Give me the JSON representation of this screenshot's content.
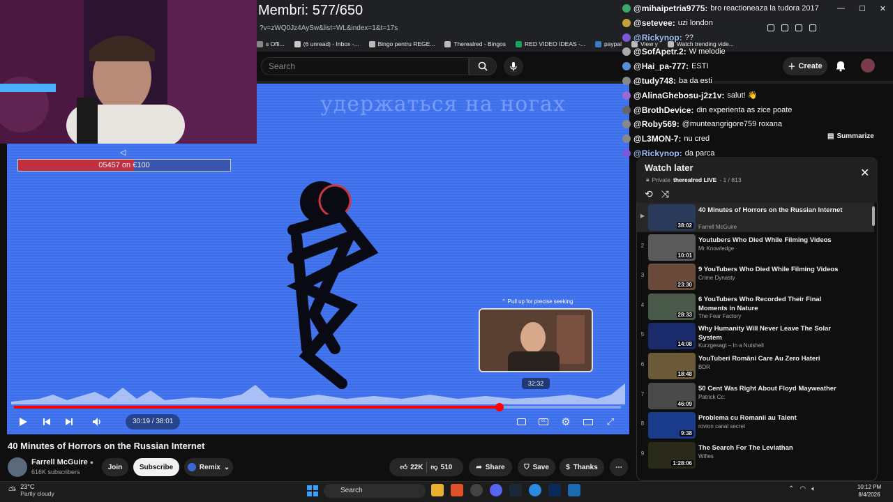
{
  "stream_overlay": {
    "members": "Membri: 577/650",
    "donation_arrow": "◁",
    "donation_text": "05457 on €100"
  },
  "browser": {
    "url": "?v=zWQ0Jz4AySw&list=WL&index=1&t=17s",
    "bookmarks": [
      {
        "label": "s Offi...",
        "color": "#888"
      },
      {
        "label": "(6 unread) - Inbox -...",
        "color": "#c9c9c9"
      },
      {
        "label": "Bingo pentru REGE...",
        "color": "#bbb"
      },
      {
        "label": "Therealred - Bingos",
        "color": "#bbb"
      },
      {
        "label": "RED VIDEO IDEAS -...",
        "color": "#1aa260"
      },
      {
        "label": "paypal",
        "color": "#3b7bbf"
      },
      {
        "label": "View y",
        "color": "#bbb"
      },
      {
        "label": "Watch trending vide...",
        "color": "#bbb"
      }
    ]
  },
  "header": {
    "search_placeholder": "Search",
    "create_label": "Create"
  },
  "chat": [
    {
      "user": "@mihaipetria9775:",
      "msg": "bro reactioneaza la tudora 2017",
      "badge": "#3aa86b"
    },
    {
      "user": "@setevee:",
      "msg": "uzi london",
      "badge": "#c9a13a"
    },
    {
      "user": "@Rickynop:",
      "msg": "??",
      "badge": "#7a5ad9",
      "user_color": "#9ec3ff"
    },
    {
      "user": "@SofApetr.2:",
      "msg": "W melodie",
      "badge": "#aaa"
    },
    {
      "user": "@Hai_pa-777:",
      "msg": "ESTI",
      "badge": "#5a8fd9"
    },
    {
      "user": "@tudy748:",
      "msg": "ba da esti",
      "badge": "#888"
    },
    {
      "user": "@AlinaGhebosu-j2z1v:",
      "msg": "salut! 👋",
      "badge": "#9a6ad0"
    },
    {
      "user": "@BrothDevice:",
      "msg": "din experienta as zice poate",
      "badge": "#666"
    },
    {
      "user": "@Roby569:",
      "msg": "@munteangrigore759 roxana",
      "badge": "#888"
    },
    {
      "user": "@L3MON-7:",
      "msg": "nu cred",
      "badge": "#888"
    },
    {
      "user": "@Rickynop:",
      "msg": "da parca",
      "badge": "#7a5ad9",
      "user_color": "#9ec3ff"
    }
  ],
  "player": {
    "title_art": "удержаться на ногах",
    "seek_hint": "⌃ Pull up for precise seeking",
    "seek_time": "32:32",
    "time": "30:19 / 38:01",
    "progress": 0.8
  },
  "video": {
    "title": "40 Minutes of Horrors on the Russian Internet",
    "channel": "Farrell McGuire",
    "subscribers": "616K subscribers",
    "join": "Join",
    "subscribe": "Subscribe",
    "remix": "Remix",
    "likes": "22K",
    "dislikes": "510",
    "share": "Share",
    "save": "Save",
    "thanks": "Thanks"
  },
  "summarize": "Summarize",
  "playlist": {
    "title": "Watch later",
    "privacy": "Private",
    "owner": "therealred LIVE",
    "count": "- 1 / 813",
    "items": [
      {
        "idx": "▶",
        "title": "40 Minutes of Horrors on the Russian Internet",
        "channel": "Farrell McGuire",
        "duration": "38:02",
        "thumb": "#2a3a5a"
      },
      {
        "idx": "2",
        "title": "Youtubers Who Died While Filming Videos",
        "channel": "Mr Knowledge",
        "duration": "10:01",
        "thumb": "#5a5a5a"
      },
      {
        "idx": "3",
        "title": "9 YouTubers Who Died While Filming Videos",
        "channel": "Crime Dynasty",
        "duration": "23:30",
        "thumb": "#6a4a3a"
      },
      {
        "idx": "4",
        "title": "6 YouTubers Who Recorded Their Final Moments in Nature",
        "channel": "The Fear Factory",
        "duration": "28:33",
        "thumb": "#4a5a4a"
      },
      {
        "idx": "5",
        "title": "Why Humanity Will Never Leave The Solar System",
        "channel": "Kurzgesagt – In a Nutshell",
        "duration": "14:08",
        "thumb": "#1a2a6a"
      },
      {
        "idx": "6",
        "title": "YouTuberi Români Care Au Zero Hateri",
        "channel": "BDR",
        "duration": "18:48",
        "thumb": "#6a5a3a"
      },
      {
        "idx": "7",
        "title": "50 Cent Was Right About Floyd Mayweather",
        "channel": "Patrick Cc:",
        "duration": "46:09",
        "thumb": "#4a4a4a"
      },
      {
        "idx": "8",
        "title": "Problema cu Romanii au Talent",
        "channel": "rovion canal secret",
        "duration": "9:38",
        "thumb": "#1a3a8a"
      },
      {
        "idx": "9",
        "title": "The Search For The Leviathan",
        "channel": "Wifies",
        "duration": "1:28:06",
        "thumb": "#2a2a1a"
      }
    ]
  },
  "taskbar": {
    "temp": "23°C",
    "weather": "Partly cloudy",
    "search": "Search",
    "time": "10:12 PM",
    "date": "8/4/2026"
  }
}
